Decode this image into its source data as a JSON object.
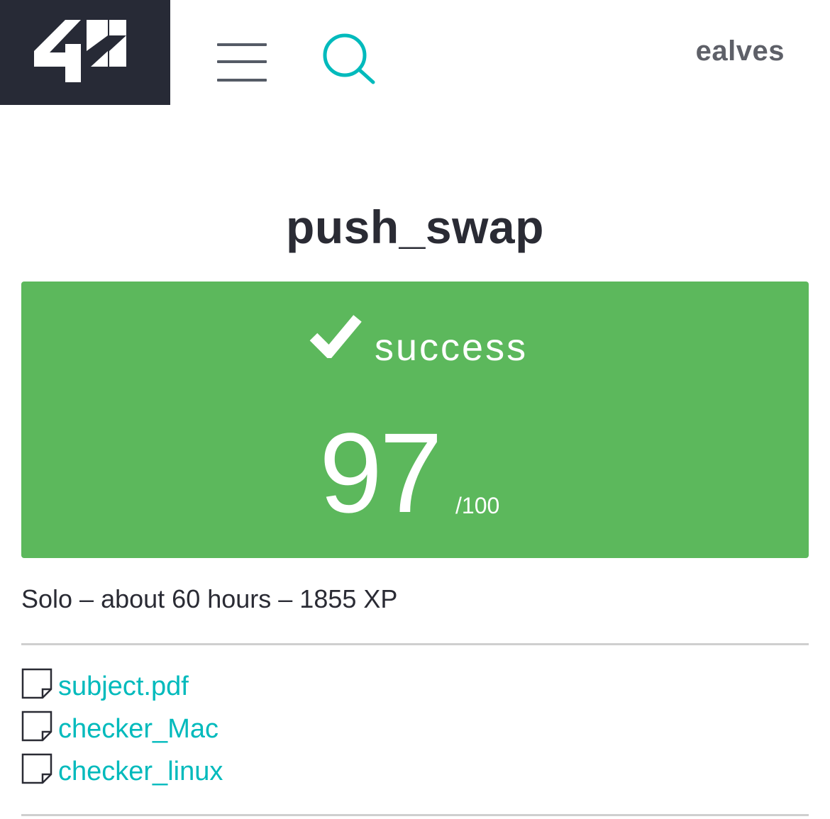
{
  "header": {
    "logo_text": "42",
    "username": "ealves",
    "colors": {
      "logo_bg": "#272a36",
      "accent": "#00babc"
    }
  },
  "project": {
    "title": "push_swap",
    "status": "success",
    "score": "97",
    "score_max": "/100",
    "meta": "Solo – about 60 hours – 1855 XP",
    "status_color": "#5cb85c"
  },
  "attachments": [
    {
      "label": "subject.pdf",
      "icon": "file-icon"
    },
    {
      "label": "checker_Mac",
      "icon": "file-icon"
    },
    {
      "label": "checker_linux",
      "icon": "file-icon"
    }
  ]
}
